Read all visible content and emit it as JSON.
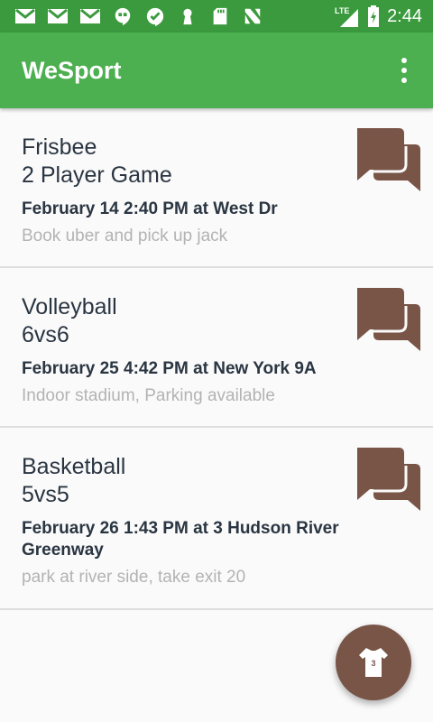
{
  "status_bar": {
    "time": "2:44",
    "network": "LTE",
    "icons": [
      "gmail-icon",
      "gmail-icon",
      "gmail-icon",
      "hangouts-icon",
      "check-icon",
      "keyhole-icon",
      "sd-card-icon",
      "n-icon"
    ]
  },
  "app_bar": {
    "title": "WeSport"
  },
  "colors": {
    "primary": "#4caf50",
    "primary_dark": "#3b9a3e",
    "accent": "#795548"
  },
  "events": [
    {
      "sport": "Frisbee",
      "mode": "2 Player Game",
      "when": "February 14 2:40 PM at  West Dr",
      "note": "Book uber and pick up jack"
    },
    {
      "sport": "Volleyball",
      "mode": "6vs6",
      "when": "February 25 4:42 PM at New York 9A",
      "note": "Indoor stadium, Parking available"
    },
    {
      "sport": "Basketball",
      "mode": "5vs5",
      "when": "February 26 1:43 PM at 3 Hudson River Greenway",
      "note": "park at river side, take exit 20"
    }
  ],
  "fab": {
    "badge": "3",
    "icon": "jersey-icon"
  }
}
